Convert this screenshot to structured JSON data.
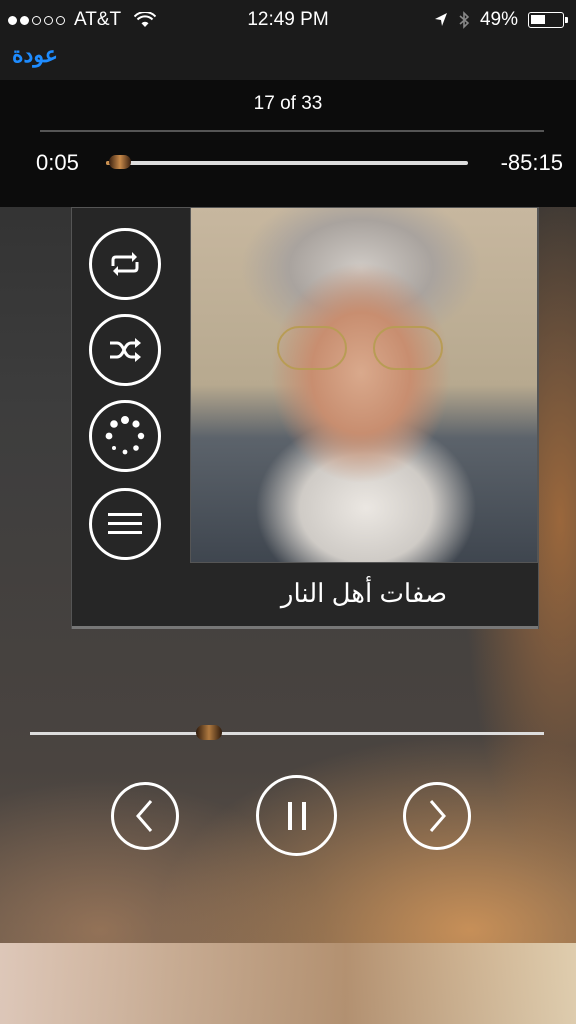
{
  "status_bar": {
    "carrier": "AT&T",
    "time": "12:49 PM",
    "battery": "49%",
    "battery_level": 0.49,
    "signal_dots_filled": 2,
    "signal_dots_total": 5,
    "icons": [
      "signal-dots-icon",
      "wifi-icon",
      "location-arrow-icon",
      "bluetooth-icon",
      "battery-icon"
    ]
  },
  "nav": {
    "back_label": "عودة"
  },
  "player": {
    "track_position": "17 of 33",
    "elapsed": "0:05",
    "remaining": "-85:15",
    "progress_fraction": 0.01,
    "seek_fraction": 0.34,
    "track_title": "صفات أهل النار",
    "side_controls": [
      "repeat-icon",
      "shuffle-icon",
      "loading-spinner-icon",
      "menu-icon"
    ],
    "transport": [
      "previous-icon",
      "pause-icon",
      "next-icon"
    ]
  },
  "colors": {
    "back_link": "#1e8cff",
    "accent": "#c98e4b"
  }
}
